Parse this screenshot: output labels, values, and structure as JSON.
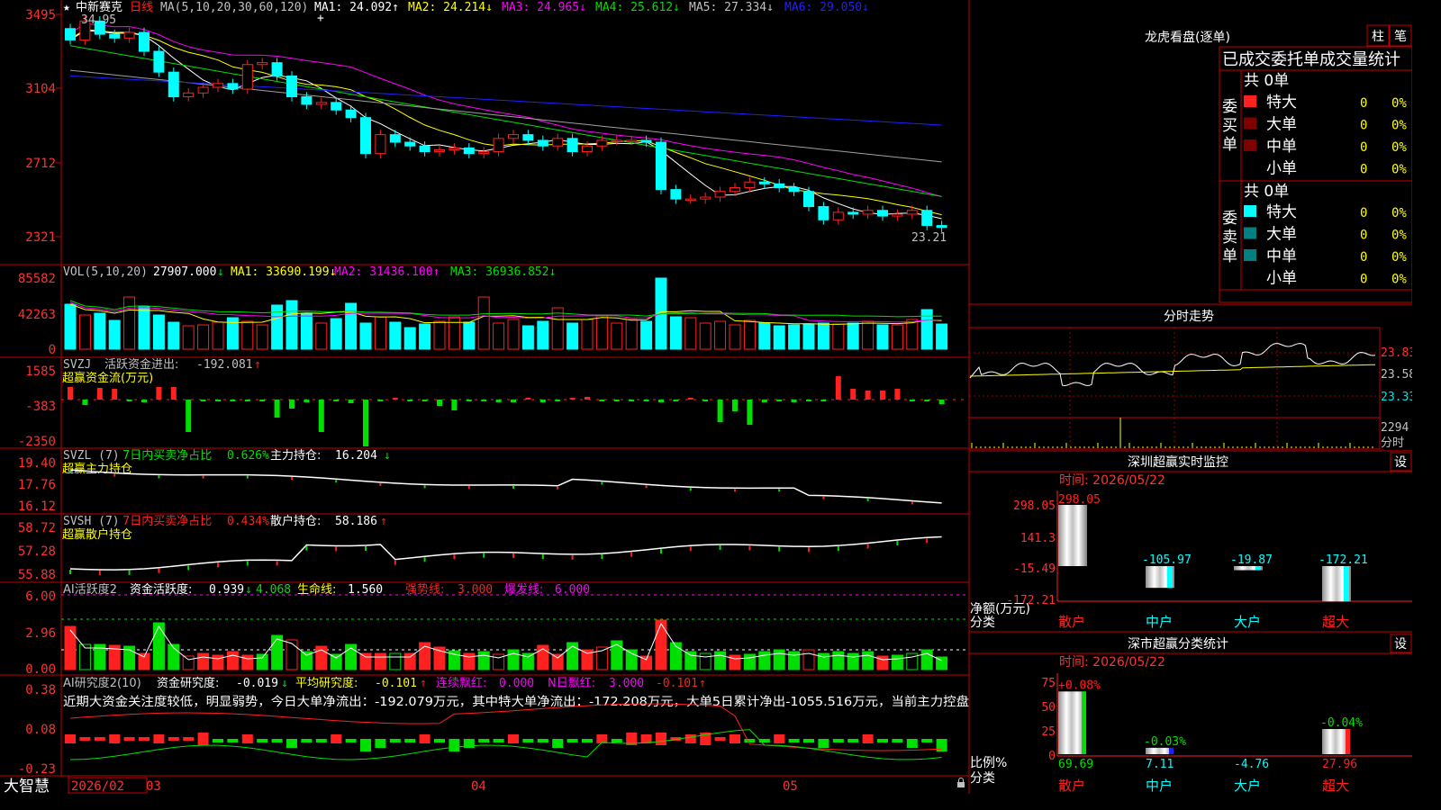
{
  "colors": {
    "up": "#ff2020",
    "down": "#00ffff",
    "grid": "#a00000",
    "frame": "#c00000",
    "white": "#ffffff",
    "yellow": "#ffff00",
    "magenta": "#ff00ff",
    "green": "#00e000",
    "gray": "#a0a0a0",
    "blue": "#2020ff",
    "teal": "#008080",
    "darkred": "#800000",
    "dim": "#c0c0c0"
  },
  "main": {
    "stock_name": "中新赛克",
    "period": "日线",
    "ma_params": "MA(5,10,20,30,60,120)",
    "ma": [
      {
        "label": "MA1:",
        "value": "24.092",
        "dir": "↑",
        "color": "#ffffff"
      },
      {
        "label": "MA2:",
        "value": "24.214",
        "dir": "↓",
        "color": "#ffff00"
      },
      {
        "label": "MA3:",
        "value": "24.965",
        "dir": "↓",
        "color": "#ff00ff"
      },
      {
        "label": "MA4:",
        "value": "25.612",
        "dir": "↓",
        "color": "#00e000"
      },
      {
        "label": "MA5:",
        "value": "27.334",
        "dir": "↓",
        "color": "#c0c0c0"
      },
      {
        "label": "MA6:",
        "value": "29.050",
        "dir": "↓",
        "color": "#2020ff"
      }
    ],
    "y_ticks": [
      "3495",
      "3104",
      "2712",
      "2321"
    ],
    "high_label": "34.95",
    "low_label": "23.21"
  },
  "vol": {
    "title": "VOL(5,10,20)",
    "value": "27907.000",
    "value_dir": "↓",
    "ma": [
      {
        "label": "MA1:",
        "value": "33690.199",
        "dir": "↓",
        "color": "#ffff00"
      },
      {
        "label": "MA2:",
        "value": "31436.100",
        "dir": "↑",
        "color": "#ff00ff"
      },
      {
        "label": "MA3:",
        "value": "36936.852",
        "dir": "↓",
        "color": "#00e000"
      }
    ],
    "y_ticks": [
      "85582",
      "42263",
      "0"
    ]
  },
  "svzj": {
    "title": "SVZJ",
    "label": "活跃资金进出:",
    "value": "-192.081",
    "dir": "↑",
    "subtitle": "超赢资金流(万元)",
    "y_ticks": [
      "1585",
      "-383",
      "-2350"
    ]
  },
  "svzl": {
    "title": "SVZL (7)",
    "label1": "7日内买卖净占比",
    "val1": "0.626%",
    "label2": "主力持仓:",
    "val2": "16.204",
    "dir": "↓",
    "subtitle": "超赢主力持仓",
    "y_ticks": [
      "19.40",
      "17.76",
      "16.12"
    ]
  },
  "svsh": {
    "title": "SVSH (7)",
    "label1": "7日内买卖净占比",
    "val1": "0.434%",
    "label2": "散户持仓:",
    "val2": "58.186",
    "dir": "↑",
    "subtitle": "超赢散户持仓",
    "y_ticks": [
      "58.72",
      "57.28",
      "55.88"
    ]
  },
  "huoyue": {
    "title": "AI活跃度2",
    "label1": "资金活跃度:",
    "val1": "0.939",
    "dir1": "↓",
    "val1b": "4.068",
    "label2": "生命线:",
    "val2": "1.560",
    "label3": "强势线:",
    "val3": "3.000",
    "label4": "爆发线:",
    "val4": "6.000",
    "y_ticks": [
      "6.00",
      "2.96",
      "0.00"
    ]
  },
  "yanjiu": {
    "title": "AI研究度2(10)",
    "label1": "资金研究度:",
    "val1": "-0.019",
    "dir1": "↓",
    "label2": "平均研究度:",
    "val2": "-0.101",
    "dir2": "↑",
    "label3": "连续飘红:",
    "val3": "0.000",
    "label4": "N日飘红:",
    "val4": "3.000",
    "val5": "-0.101",
    "dir5": "↑",
    "note": "近期大资金关注度较低，明显弱势，今日大单净流出：-192.079万元，其中特大单净流出：-172.208万元，大单5日累计净出-1055.516万元，当前主力控盘",
    "y_ticks": [
      "0.38",
      "0.08",
      "-0.23"
    ]
  },
  "bottom": {
    "brand": "大智慧",
    "dates": [
      "2026/02",
      "03",
      "04",
      "05"
    ]
  },
  "right": {
    "lhb_title": "龙虎看盘(逐单)",
    "btn_zhu": "柱",
    "btn_bi": "笔",
    "stat_title": "已成交委托单成交量统计",
    "buy_side": "委买单",
    "sell_side": "委卖单",
    "buy_count": "共 0单",
    "sell_count": "共 0单",
    "categories": [
      "特大",
      "大单",
      "中单",
      "小单"
    ],
    "zero": "0",
    "pct": "0%",
    "fenshi_title": "分时走势",
    "fenshi_prices": [
      "23.83",
      "23.58",
      "23.33"
    ],
    "fenshi_vol": "2294",
    "fenshi_vol_label": "分时",
    "monitor_title": "深圳超赢实时监控",
    "monitor_btn": "设",
    "monitor_time": "时间: 2026/05/22",
    "monitor_y": [
      "298.05",
      "141.3",
      "-15.49",
      "-172.21"
    ],
    "monitor_axis_label": "净额(万元)",
    "monitor_axis_label2": "分类",
    "monitor_values": [
      "298.05",
      "-105.97",
      "-19.87",
      "-172.21"
    ],
    "monitor_nums": [
      298.05,
      -105.97,
      -19.87,
      -172.21
    ],
    "cats": [
      "散户",
      "中户",
      "大户",
      "超大"
    ],
    "stat2_title": "深市超赢分类统计",
    "stat2_btn": "设",
    "stat2_time": "时间: 2026/05/22",
    "stat2_y": [
      "75",
      "50",
      "25",
      "0"
    ],
    "stat2_axis_label": "比例%",
    "stat2_axis_label2": "分类",
    "stat2_top": [
      "+0.08%",
      "-0.03%",
      "",
      "-0.04%"
    ],
    "stat2_values": [
      "69.69",
      "7.11",
      "-4.76",
      "27.96"
    ],
    "stat2_nums": [
      69.69,
      7.11,
      -4.76,
      27.96
    ]
  }
}
